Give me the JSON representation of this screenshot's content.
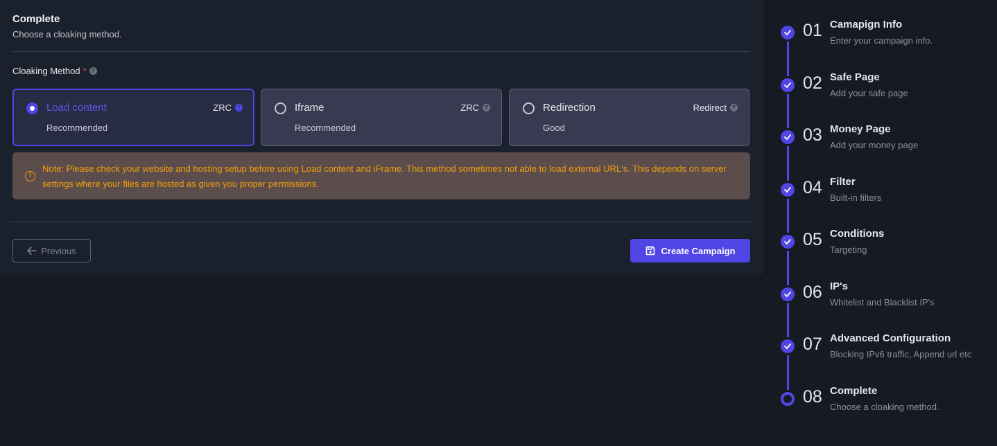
{
  "header": {
    "title": "Complete",
    "subtitle": "Choose a cloaking method."
  },
  "field": {
    "label": "Cloaking Method",
    "required_mark": "*",
    "help_glyph": "?"
  },
  "options": [
    {
      "name": "Load content",
      "desc": "Recommended",
      "tag": "ZRC",
      "selected": true
    },
    {
      "name": "Iframe",
      "desc": "Recommended",
      "tag": "ZRC",
      "selected": false
    },
    {
      "name": "Redirection",
      "desc": "Good",
      "tag": "Redirect",
      "selected": false
    }
  ],
  "note": {
    "icon": "warning-circle-icon",
    "text": "Note: Please check your website and hosting setup before using Load content and iFrame. This method sometimes not able to load external URL's. This depends on server settings where your files are hosted as given you proper permissions."
  },
  "buttons": {
    "previous": "Previous",
    "create": "Create Campaign"
  },
  "steps": [
    {
      "num": "01",
      "title": "Camapign Info",
      "desc": "Enter your campaign info.",
      "status": "done"
    },
    {
      "num": "02",
      "title": "Safe Page",
      "desc": "Add your safe page",
      "status": "done"
    },
    {
      "num": "03",
      "title": "Money Page",
      "desc": "Add your money page",
      "status": "done"
    },
    {
      "num": "04",
      "title": "Filter",
      "desc": "Built-in filters",
      "status": "done"
    },
    {
      "num": "05",
      "title": "Conditions",
      "desc": "Targeting",
      "status": "done"
    },
    {
      "num": "06",
      "title": "IP's",
      "desc": "Whitelist and Blacklist IP's",
      "status": "done"
    },
    {
      "num": "07",
      "title": "Advanced Configuration",
      "desc": "Blocking IPv6 traffic, Append url etc",
      "status": "done"
    },
    {
      "num": "08",
      "title": "Complete",
      "desc": "Choose a cloaking method.",
      "status": "current"
    }
  ],
  "colors": {
    "accent": "#4f46e5",
    "warning": "#f59e0b",
    "required": "#ef4444"
  }
}
